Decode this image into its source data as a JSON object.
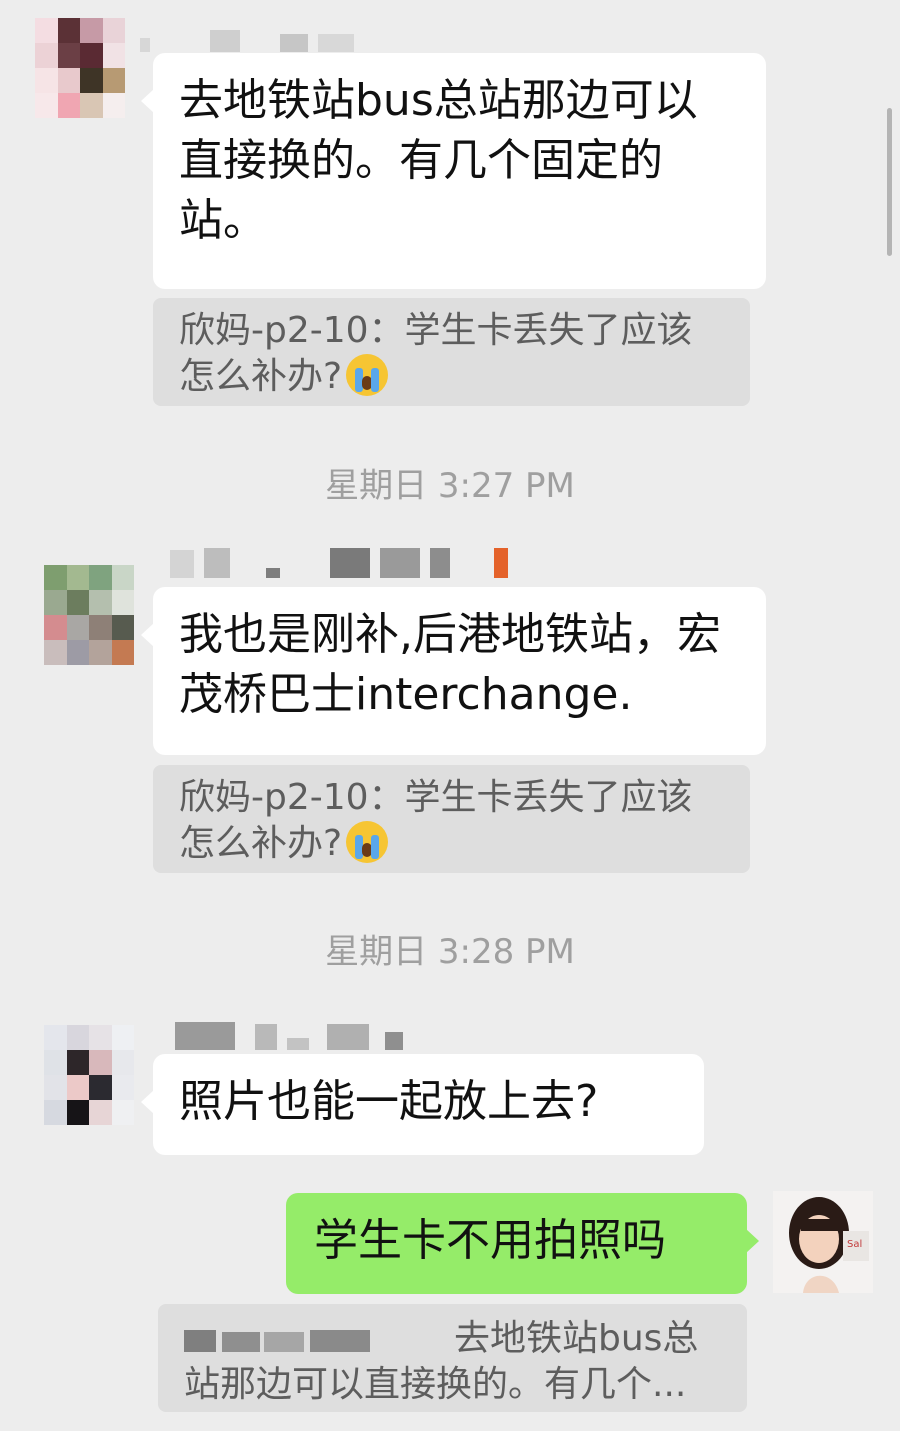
{
  "messages": [
    {
      "text": "去地铁站bus总站那边可以直接换的。有几个固定的站。",
      "quote": "欣妈-p2-10：学生卡丢失了应该怎么补办?"
    },
    {
      "text": "我也是刚补,后港地铁站，宏茂桥巴士interchange.",
      "quote": "欣妈-p2-10：学生卡丢失了应该怎么补办?"
    },
    {
      "text": "照片也能一起放上去?"
    },
    {
      "text": "学生卡不用拍照吗",
      "quote": "去地铁站bus总站那边可以直接换的。有几个..."
    }
  ],
  "timestamps": [
    "星期日 3:27 PM",
    "星期日 3:28 PM"
  ],
  "emoji": "loudly-crying-face",
  "colors": {
    "background": "#ededed",
    "incoming_bubble": "#ffffff",
    "outgoing_bubble": "#95ec69",
    "quote_background": "#dedede",
    "quote_text": "#5d5d5d",
    "timestamp_text": "#9f9f9f"
  }
}
